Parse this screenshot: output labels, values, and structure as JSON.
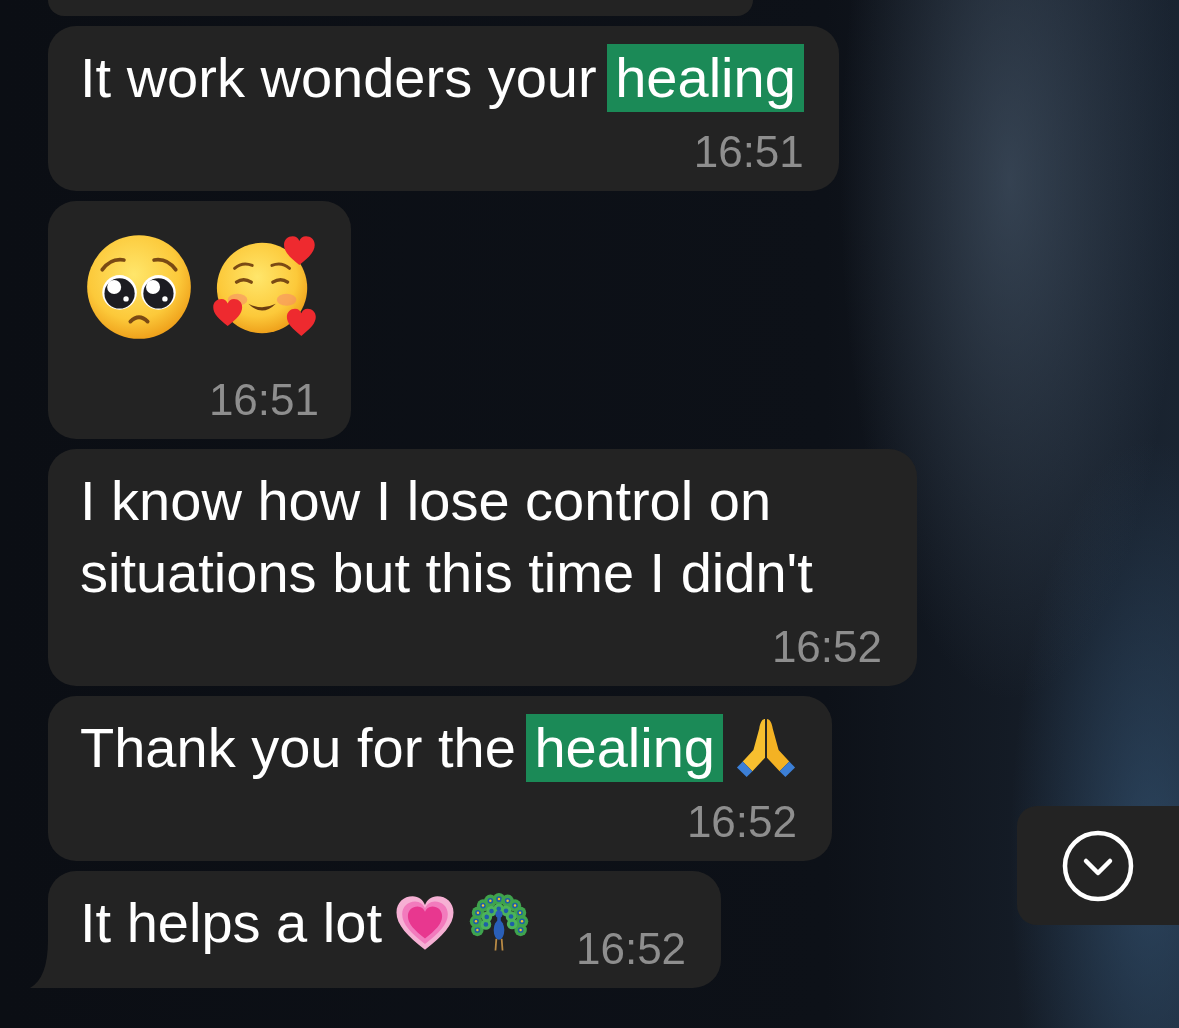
{
  "messages": [
    {
      "kind": "cut_off",
      "tail": false
    },
    {
      "kind": "text",
      "tail": false,
      "parts": [
        {
          "kind": "text",
          "text": "It work wonders your "
        },
        {
          "kind": "highlight",
          "text": "healing"
        }
      ],
      "time": "16:51"
    },
    {
      "kind": "jumbo",
      "tail": false,
      "emojis": [
        {
          "kind": "pleading"
        },
        {
          "kind": "adoring"
        }
      ],
      "time": "16:51"
    },
    {
      "kind": "text",
      "tail": false,
      "parts": [
        {
          "kind": "text",
          "text": "I know how I lose control on situations but this time I didn't"
        }
      ],
      "time": "16:52"
    },
    {
      "kind": "text",
      "tail": false,
      "parts": [
        {
          "kind": "text",
          "text": "Thank you for the "
        },
        {
          "kind": "highlight",
          "text": "healing"
        }
      ],
      "emojis": [
        {
          "kind": "prayer"
        }
      ],
      "time": "16:52"
    },
    {
      "kind": "inline",
      "tail": true,
      "parts": [
        {
          "kind": "text",
          "text": "It helps a lot"
        }
      ],
      "emojis": [
        {
          "kind": "heart"
        },
        {
          "kind": "peacock"
        }
      ],
      "time": "16:52"
    }
  ],
  "scroll_down_button": {
    "shown": true
  }
}
